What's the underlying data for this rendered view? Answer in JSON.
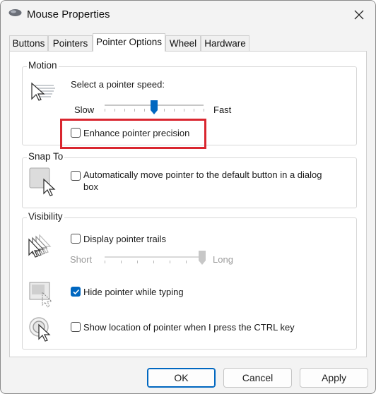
{
  "window": {
    "title": "Mouse Properties",
    "close_icon": "close-icon"
  },
  "tabs": [
    {
      "label": "Buttons",
      "active": false
    },
    {
      "label": "Pointers",
      "active": false
    },
    {
      "label": "Pointer Options",
      "active": true
    },
    {
      "label": "Wheel",
      "active": false
    },
    {
      "label": "Hardware",
      "active": false
    }
  ],
  "motion": {
    "group_label": "Motion",
    "speed_label": "Select a pointer speed:",
    "slow_label": "Slow",
    "fast_label": "Fast",
    "speed_value_fraction": 0.5,
    "precision_label": "Enhance pointer precision",
    "precision_checked": false
  },
  "snap_to": {
    "group_label": "Snap To",
    "option_label_line1": "Automatically move pointer to the default button in a dialog",
    "option_label_line2": "box",
    "checked": false
  },
  "visibility": {
    "group_label": "Visibility",
    "trails_label": "Display pointer trails",
    "trails_checked": false,
    "short_label": "Short",
    "long_label": "Long",
    "trail_length_fraction": 1.0,
    "hide_label": "Hide pointer while typing",
    "hide_checked": true,
    "ctrl_label": "Show location of pointer when I press the CTRL key",
    "ctrl_checked": false
  },
  "buttons": {
    "ok": "OK",
    "cancel": "Cancel",
    "apply": "Apply"
  },
  "colors": {
    "accent": "#0067c0",
    "highlight_box": "#d9262f"
  }
}
